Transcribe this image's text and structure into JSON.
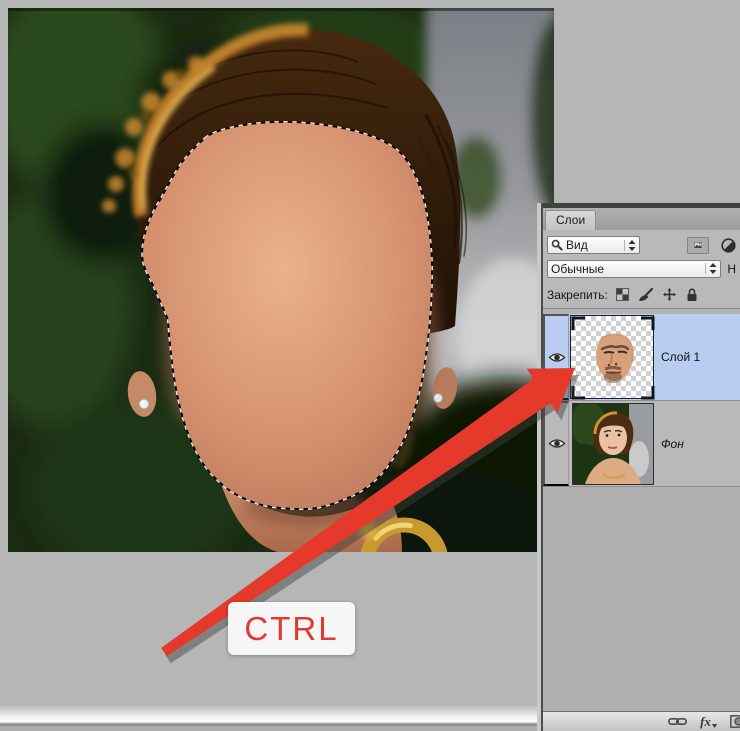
{
  "window": {
    "background_color": "#b6b6b6"
  },
  "annotation": {
    "label": "CTRL",
    "label_color": "#e0392d",
    "label_bg": "#f6f6f6",
    "arrow_color": "#e5392b"
  },
  "panel": {
    "tab_label": "Слои",
    "search_filter": {
      "label": "Вид",
      "icon": "magnifier-icon"
    },
    "filter_buttons": {
      "icons": [
        "image-filter-icon",
        "adjustment-filter-icon"
      ]
    },
    "blend_mode": {
      "value": "Обычные"
    },
    "opacity_clipped_label": "Н",
    "lock": {
      "label": "Закрепить:",
      "icons": [
        "lock-transparency-icon",
        "lock-paint-icon",
        "lock-move-icon",
        "lock-all-icon"
      ]
    },
    "layers": [
      {
        "name": "Слой 1",
        "selected": true,
        "visible": true,
        "thumbnail": "pasted face on transparent checkerboard, selection brackets"
      },
      {
        "name": "Фон",
        "selected": false,
        "visible": true,
        "thumbnail": "woman portrait photo"
      }
    ],
    "bottom_bar": {
      "fx_label": "fx",
      "icons": [
        "link-layers-icon",
        "layer-style-fx-icon",
        "layer-mask-icon"
      ]
    },
    "colors": {
      "panel_bg": "#b9b9b9",
      "selected_row": "#b9cdf2"
    }
  },
  "document": {
    "selection_active": true,
    "content": "portrait photo with pasted male face selection over woman on green background"
  }
}
